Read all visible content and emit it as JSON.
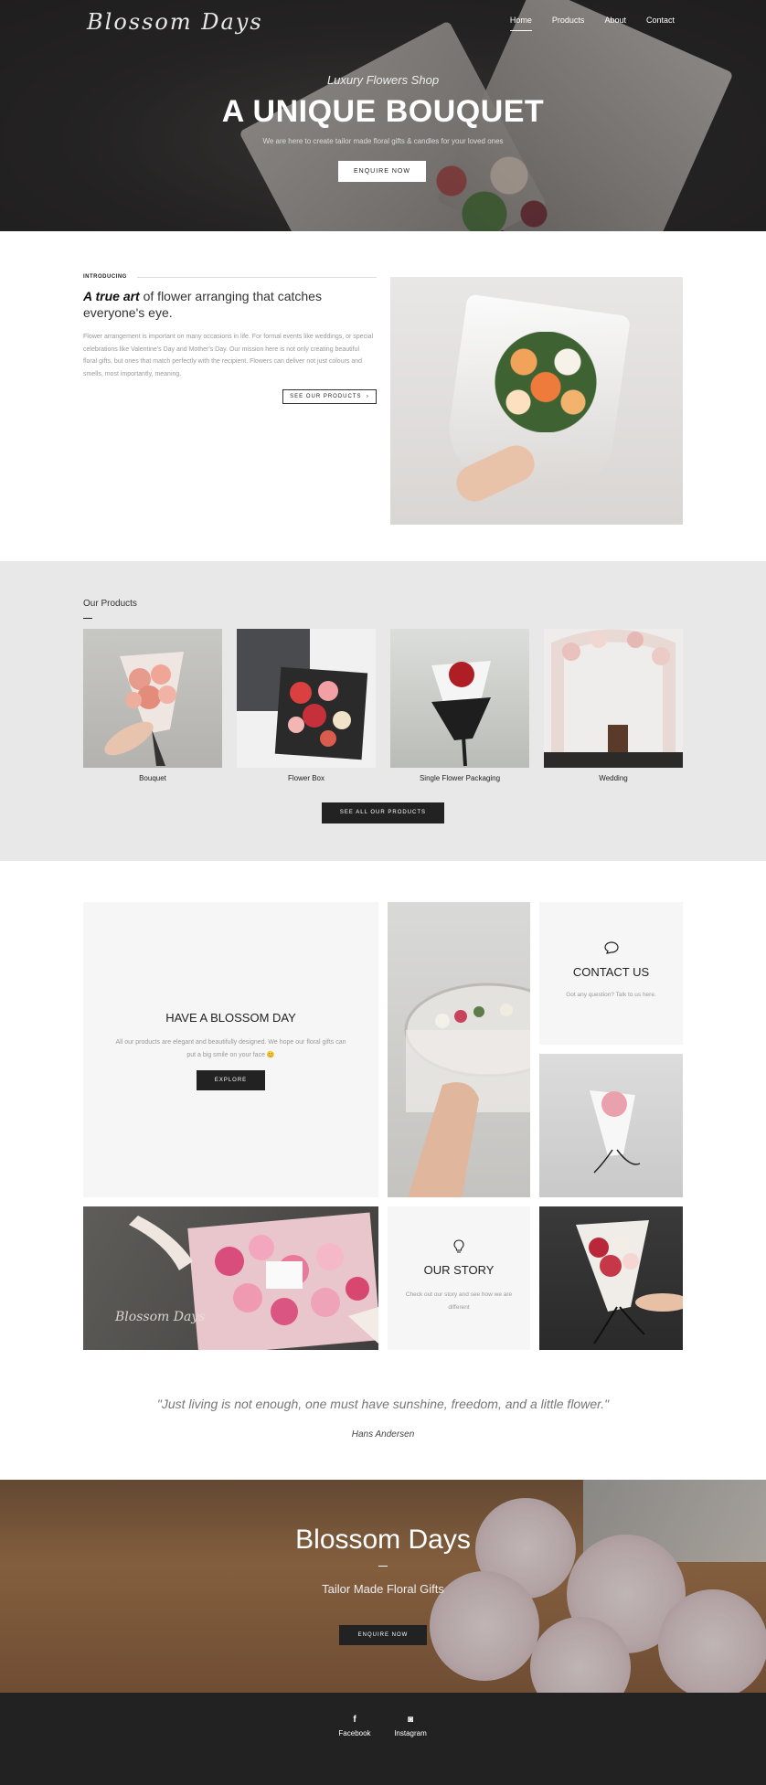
{
  "header": {
    "logo": "Blossom Days",
    "nav": [
      "Home",
      "Products",
      "About",
      "Contact"
    ],
    "active_nav": "Home"
  },
  "hero": {
    "subtitle": "Luxury Flowers Shop",
    "title": "A UNIQUE BOUQUET",
    "text": "We are here to create tailor made floral gifts & candles for your loved ones",
    "button": "ENQUIRE NOW"
  },
  "intro": {
    "label": "INTRODUCING",
    "heading_emphasis": "A true art",
    "heading_rest": " of flower arranging that catches everyone's eye.",
    "body": "Flower arrangement is important on many occasions in life. For formal events like weddings, or special celebrations like Valentine's Day and Mother's Day. Our mission here is not only creating beautiful floral gifts, but ones that match perfectly with the recipient. Flowers can deliver not just colours and smells, most importantly, meaning.",
    "button": "SEE OUR PRODUCTS",
    "button_arrow": "›"
  },
  "products": {
    "title": "Our Products",
    "items": [
      "Bouquet",
      "Flower Box",
      "Single Flower Packaging",
      "Wedding"
    ],
    "button": "SEE ALL OUR PRODUCTS"
  },
  "grid": {
    "blossom": {
      "title": "HAVE A BLOSSOM DAY",
      "text": "All our products are elegant and beautifully designed. We hope our floral gifts can put a big smile on your face",
      "emoji": "😊",
      "button": "EXPLORE"
    },
    "contact": {
      "icon": "speech-bubble-icon",
      "glyph": "💬",
      "title": "CONTACT US",
      "text": "Got any question? Talk to us here."
    },
    "story": {
      "icon": "lightbulb-icon",
      "glyph": "💡",
      "title": "OUR STORY",
      "text": "Check out our story and see how we are different"
    },
    "box_watermark": "Blossom Days"
  },
  "quote": {
    "text": "\"Just living is not enough, one must have sunshine, freedom, and a little flower.\"",
    "author": "Hans Andersen"
  },
  "banner": {
    "title": "Blossom Days",
    "subtitle": "Tailor Made Floral Gifts",
    "button": "ENQUIRE NOW"
  },
  "footer": {
    "social": [
      {
        "label": "Facebook",
        "glyph": "f"
      },
      {
        "label": "Instagram",
        "glyph": "◙"
      }
    ]
  },
  "colors": {
    "dark": "#222222",
    "light_gray_bg": "#e8e8e8",
    "tile_bg": "#f6f6f6",
    "muted_text": "#999999"
  }
}
